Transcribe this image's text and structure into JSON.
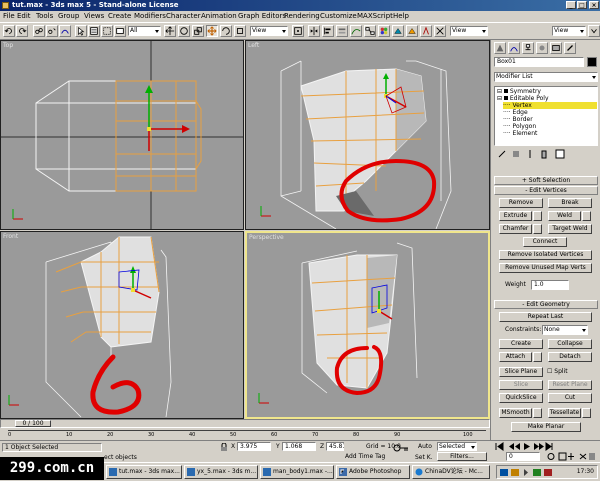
{
  "window": {
    "title": "tut.max - 3ds max 5 - Stand-alone License",
    "min": "_",
    "max": "□",
    "close": "×"
  },
  "menu": [
    "File",
    "Edit",
    "Tools",
    "Group",
    "Views",
    "Create",
    "Modifiers",
    "Character",
    "Animation",
    "Graph Editors",
    "Rendering",
    "Customize",
    "MAXScript",
    "Help"
  ],
  "toolbar": {
    "selection_filter": "All",
    "ref_coord": "View",
    "ref_coord_right": "View"
  },
  "viewports": {
    "top": "Top",
    "left": "Left",
    "front": "Front",
    "perspective": "Perspective"
  },
  "command_panel": {
    "object_name": "Box01",
    "modifier_list": "Modifier List",
    "stack": [
      "Symmetry",
      "Editable Poly",
      "Vertex",
      "Edge",
      "Border",
      "Polygon",
      "Element"
    ],
    "selected_stack_item": "Vertex",
    "rollout_soft_selection": "Soft Selection",
    "rollout_edit_vertices": "Edit Vertices",
    "btn_remove": "Remove",
    "btn_break": "Break",
    "btn_extrude": "Extrude",
    "btn_weld": "Weld",
    "btn_chamfer": "Chamfer",
    "btn_target_weld": "Target Weld",
    "btn_connect": "Connect",
    "btn_remove_isolated": "Remove Isolated Vertices",
    "btn_remove_unused": "Remove Unused Map Verts",
    "weight_label": "Weight",
    "weight_value": "1.0",
    "rollout_edit_geometry": "Edit Geometry",
    "btn_repeat_last": "Repeat Last",
    "constraints_label": "Constraints:",
    "constraints_value": "None",
    "btn_create": "Create",
    "btn_collapse": "Collapse",
    "btn_attach": "Attach",
    "btn_detach": "Detach",
    "btn_slice_plane": "Slice Plane",
    "btn_split": "Split",
    "btn_slice": "Slice",
    "btn_reset_plane": "Reset Plane",
    "btn_quickslice": "QuickSlice",
    "btn_cut": "Cut",
    "btn_msmooth": "MSmooth",
    "btn_tessellate": "Tessellate",
    "btn_make_planar": "Make Planar"
  },
  "timeline": {
    "frame_counter": "0 / 100",
    "ticks": [
      "0",
      "10",
      "20",
      "30",
      "40",
      "50",
      "60",
      "70",
      "80",
      "90",
      "100"
    ]
  },
  "status": {
    "selection": "1 Object Selected",
    "prompt": "ect objects",
    "x_label": "X",
    "x_value": "3.975",
    "y_label": "Y",
    "y_value": "1.068",
    "z_label": "Z",
    "z_value": "45.819",
    "grid": "Grid = 10.0",
    "add_time_tag": "Add Time Tag",
    "auto_label": "Auto",
    "setk_label": "Set K.",
    "selected_dd": "Selected",
    "filters": "Filters...",
    "frame": "0"
  },
  "taskbar": {
    "items": [
      "tut.max - 3ds max...",
      "yx_5.max - 3ds m...",
      "man_body1.max -...",
      "Adobe Photoshop",
      "ChinaDV论坛 - Mc..."
    ],
    "clock": "17:30"
  },
  "watermark": "299.com.cn",
  "colors": {
    "title_start": "#0a246a",
    "title_end": "#3a6ea5",
    "viewport_bg": "#9a9a9a",
    "active_border": "#f0e68c",
    "wire_orange": "#e8a040",
    "annotation_red": "#e00000",
    "vertex_highlight": "#f0e030"
  }
}
